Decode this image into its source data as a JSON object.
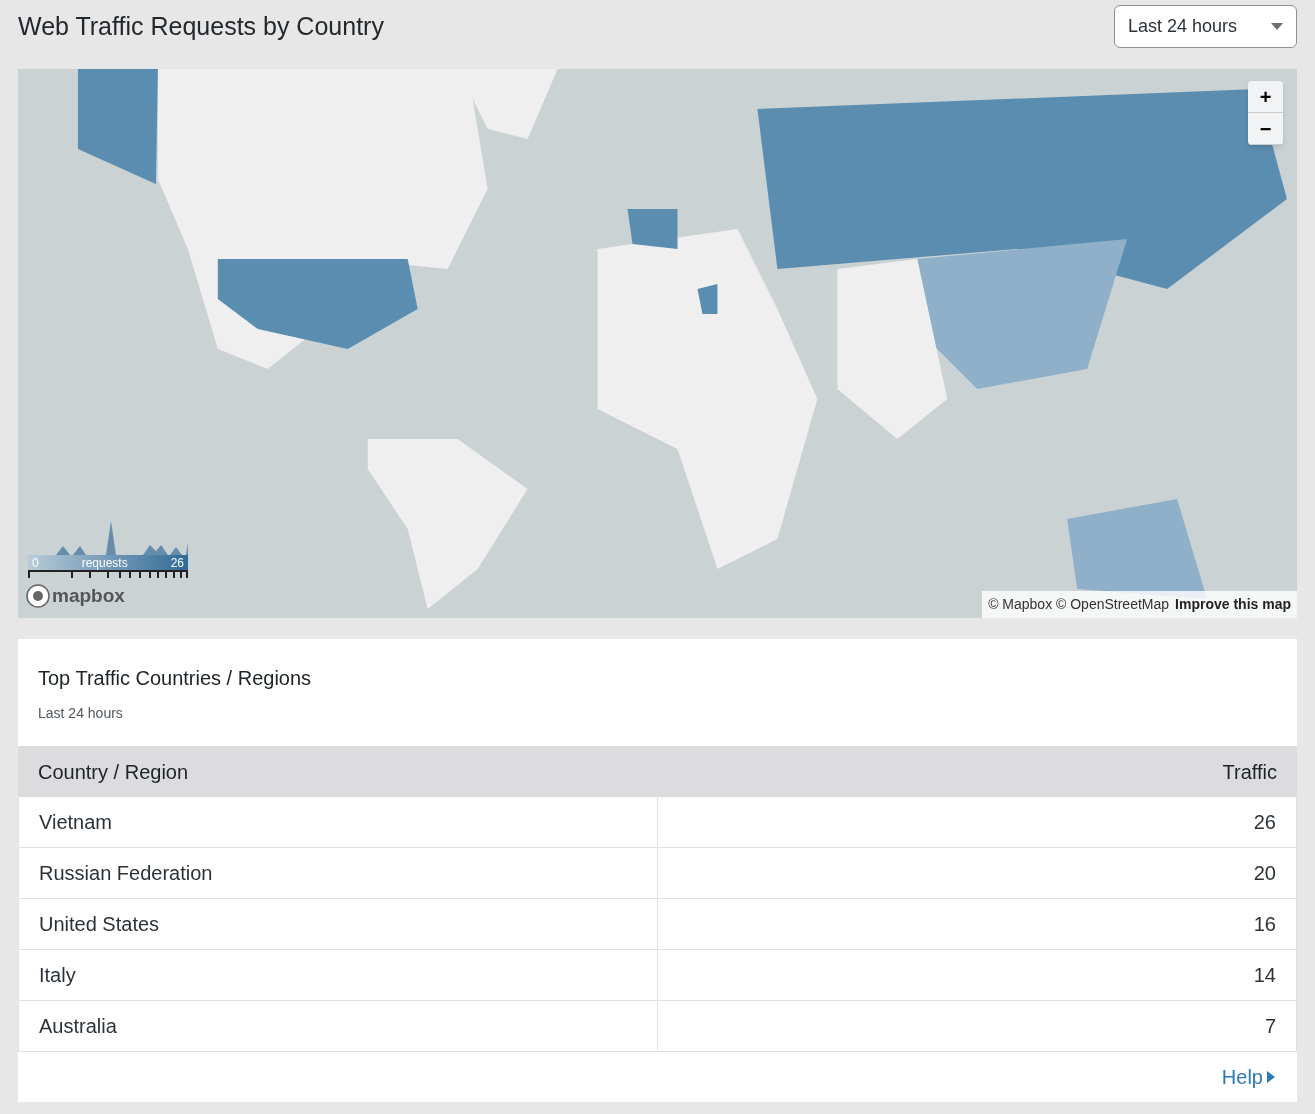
{
  "page": {
    "title": "Web Traffic Requests by Country"
  },
  "range_select": {
    "value": "Last 24 hours"
  },
  "map": {
    "kind": "picture",
    "zoom_controls": [
      "+",
      "−"
    ],
    "legend": {
      "min": "0",
      "label": "requests",
      "max": "26"
    },
    "logo": "mapbox",
    "attribution": "© Mapbox © OpenStreetMap",
    "improve_link": "Improve this map"
  },
  "card": {
    "title": "Top Traffic Countries / Regions",
    "subtitle": "Last 24 hours",
    "table": {
      "columns": [
        "Country / Region",
        "Traffic"
      ],
      "rows": [
        [
          "Vietnam",
          "26"
        ],
        [
          "Russian Federation",
          "20"
        ],
        [
          "United States",
          "16"
        ],
        [
          "Italy",
          "14"
        ],
        [
          "Australia",
          "7"
        ]
      ]
    },
    "help_link": "Help"
  }
}
